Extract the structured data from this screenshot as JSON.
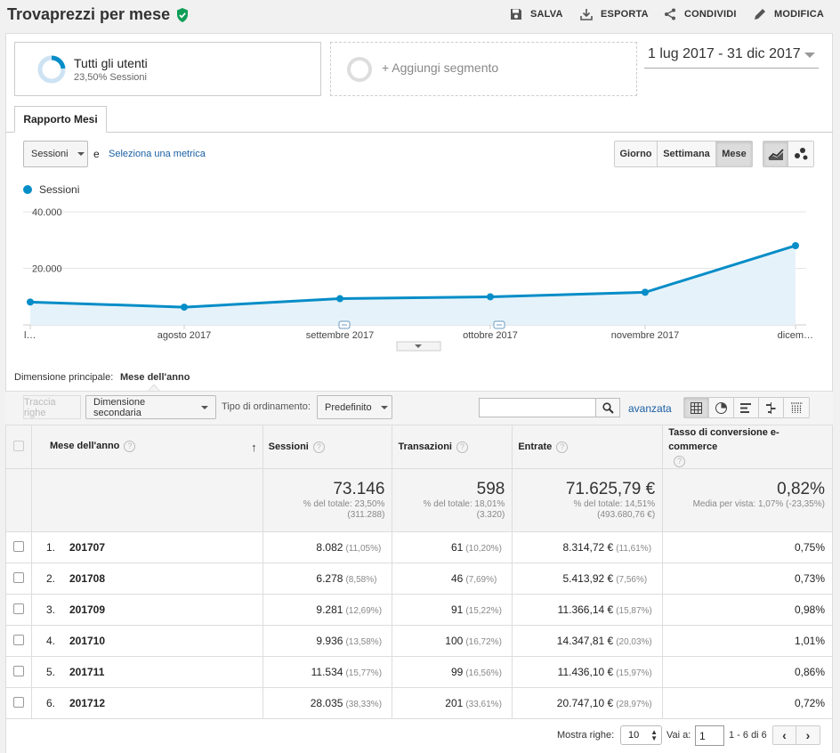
{
  "header": {
    "title": "Trovaprezzi per mese",
    "actions": [
      {
        "label": "SALVA",
        "icon": "save-icon"
      },
      {
        "label": "ESPORTA",
        "icon": "export-icon"
      },
      {
        "label": "CONDIVIDI",
        "icon": "share-icon"
      },
      {
        "label": "MODIFICA",
        "icon": "edit-icon"
      }
    ]
  },
  "segments": {
    "active_title": "Tutti gli utenti",
    "active_sub": "23,50% Sessioni",
    "add_label": "+ Aggiungi segmento"
  },
  "date_range": "1 lug 2017 - 31 dic 2017",
  "report_tab": "Rapporto Mesi",
  "metric_controls": {
    "metric_select": "Sessioni",
    "and_label": "e",
    "select_metric_link": "Seleziona una metrica",
    "period_buttons": [
      "Giorno",
      "Settimana",
      "Mese"
    ],
    "active_period": "Mese"
  },
  "chart_data": {
    "type": "area",
    "legend": [
      "Sessioni"
    ],
    "color": "#058dc7",
    "fill": "#e6f2fa",
    "x": [
      "l…",
      "agosto 2017",
      "settembre 2017",
      "ottobre 2017",
      "novembre 2017",
      "dicem…"
    ],
    "series": [
      {
        "name": "Sessioni",
        "values": [
          8082,
          6278,
          9281,
          9936,
          11534,
          28035
        ]
      }
    ],
    "ylim": [
      0,
      40000
    ],
    "y_ticks": [
      "40.000",
      "20.000"
    ],
    "grid": true
  },
  "dimension": {
    "label": "Dimensione principale:",
    "value": "Mese dell'anno"
  },
  "table_controls": {
    "plot_rows": "Traccia righe",
    "secondary_dim": "Dimensione secondaria",
    "sort_label": "Tipo di ordinamento:",
    "sort_value": "Predefinito",
    "search_placeholder": "",
    "advanced": "avanzata"
  },
  "table": {
    "columns": [
      "Mese dell'anno",
      "Sessioni",
      "Transazioni",
      "Entrate",
      "Tasso di conversione e-commerce"
    ],
    "totals": {
      "sessions": "73.146",
      "sessions_sub1": "% del totale: 23,50%",
      "sessions_sub2": "(311.288)",
      "transactions": "598",
      "transactions_sub1": "% del totale: 18,01%",
      "transactions_sub2": "(3.320)",
      "revenue": "71.625,79 €",
      "revenue_sub1": "% del totale: 14,51%",
      "revenue_sub2": "(493.680,76 €)",
      "conversion": "0,82%",
      "conversion_sub1": "Media per vista: 1,07% (-23,35%)"
    },
    "rows": [
      {
        "idx": "1.",
        "month": "201707",
        "sessions": "8.082",
        "sessions_pct": "(11,05%)",
        "trans": "61",
        "trans_pct": "(10,20%)",
        "revenue": "8.314,72 €",
        "revenue_pct": "(11,61%)",
        "conv": "0,75%"
      },
      {
        "idx": "2.",
        "month": "201708",
        "sessions": "6.278",
        "sessions_pct": "(8,58%)",
        "trans": "46",
        "trans_pct": "(7,69%)",
        "revenue": "5.413,92 €",
        "revenue_pct": "(7,56%)",
        "conv": "0,73%"
      },
      {
        "idx": "3.",
        "month": "201709",
        "sessions": "9.281",
        "sessions_pct": "(12,69%)",
        "trans": "91",
        "trans_pct": "(15,22%)",
        "revenue": "11.366,14 €",
        "revenue_pct": "(15,87%)",
        "conv": "0,98%"
      },
      {
        "idx": "4.",
        "month": "201710",
        "sessions": "9.936",
        "sessions_pct": "(13,58%)",
        "trans": "100",
        "trans_pct": "(16,72%)",
        "revenue": "14.347,81 €",
        "revenue_pct": "(20,03%)",
        "conv": "1,01%"
      },
      {
        "idx": "5.",
        "month": "201711",
        "sessions": "11.534",
        "sessions_pct": "(15,77%)",
        "trans": "99",
        "trans_pct": "(16,56%)",
        "revenue": "11.436,10 €",
        "revenue_pct": "(15,97%)",
        "conv": "0,86%"
      },
      {
        "idx": "6.",
        "month": "201712",
        "sessions": "28.035",
        "sessions_pct": "(38,33%)",
        "trans": "201",
        "trans_pct": "(33,61%)",
        "revenue": "20.747,10 €",
        "revenue_pct": "(28,97%)",
        "conv": "0,72%"
      }
    ]
  },
  "footer": {
    "show_rows_label": "Mostra righe:",
    "show_rows_value": "10",
    "goto_label": "Vai a:",
    "goto_value": "1",
    "range": "1 - 6 di 6"
  }
}
